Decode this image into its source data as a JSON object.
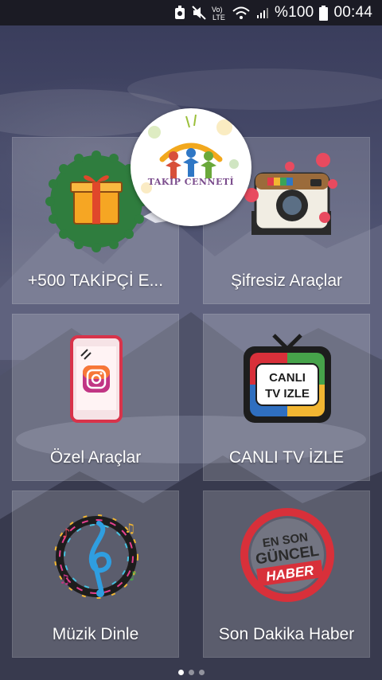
{
  "status_bar": {
    "battery_percent": "%100",
    "time": "00:44",
    "icons": [
      "notification-icon",
      "mute-icon",
      "volte-icon",
      "wifi-icon",
      "signal-icon",
      "battery-icon"
    ]
  },
  "logo": {
    "text": "TAKİP CENNETİ",
    "icon": "takip-cenneti-logo"
  },
  "tiles": [
    {
      "label": "+500 TAKİPÇİ E...",
      "icon": "gift-icon"
    },
    {
      "label": "Şifresiz Araçlar",
      "icon": "instagram-camera-icon"
    },
    {
      "label": "Özel Araçlar",
      "icon": "phone-instagram-icon"
    },
    {
      "label": "CANLI TV İZLE",
      "icon": "tv-icon"
    },
    {
      "label": "Müzik Dinle",
      "icon": "music-icon"
    },
    {
      "label": "Son Dakika Haber",
      "icon": "news-icon"
    }
  ],
  "art_text": {
    "tv_line1": "CANLI",
    "tv_line2": "TV IZLE",
    "news_line1": "EN SON",
    "news_line2": "GÜNCEL",
    "news_line3": "HABER"
  },
  "pager": {
    "pages": 3,
    "active": 0
  },
  "colors": {
    "tile_bg": "rgba(255,255,255,0.18)",
    "status_bar": "#1b1b24",
    "gift_green": "#2f7d3e",
    "gift_orange": "#f6a623"
  }
}
